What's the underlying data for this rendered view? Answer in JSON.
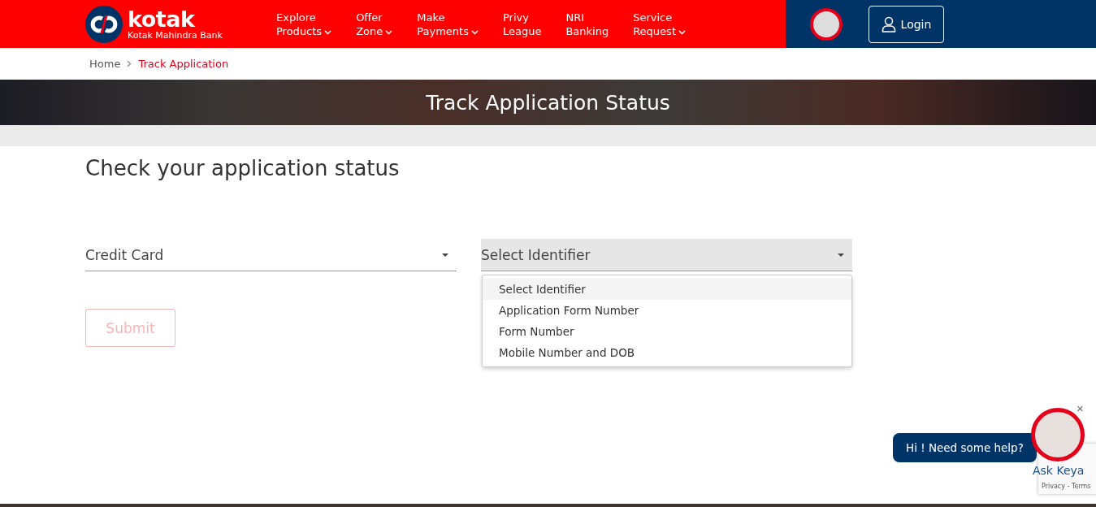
{
  "header": {
    "brand": "kotak",
    "brand_sub": "Kotak Mahindra Bank",
    "nav": [
      {
        "line1": "Explore",
        "line2": "Products",
        "caret": true
      },
      {
        "line1": "Offer",
        "line2": "Zone",
        "caret": true
      },
      {
        "line1": "Make",
        "line2": "Payments",
        "caret": true
      },
      {
        "line1": "Privy",
        "line2": "League",
        "caret": false
      },
      {
        "line1": "NRI",
        "line2": "Banking",
        "caret": false
      },
      {
        "line1": "Service",
        "line2": "Request",
        "caret": true
      }
    ],
    "login": "Login"
  },
  "breadcrumb": [
    {
      "label": "Home",
      "selected": false
    },
    {
      "label": "Track Application",
      "selected": true
    }
  ],
  "banner": {
    "title": "Track Application Status"
  },
  "form": {
    "heading": "Check your application status",
    "product_select": {
      "value": "Credit Card"
    },
    "identifier_select": {
      "value": "Select Identifier",
      "expanded": true,
      "options": [
        {
          "label": "Select Identifier",
          "selected": true
        },
        {
          "label": "Application Form Number",
          "selected": false
        },
        {
          "label": "Form Number",
          "selected": false
        },
        {
          "label": "Mobile Number and DOB",
          "selected": false
        }
      ]
    },
    "submit": {
      "label": "Submit",
      "disabled": true
    }
  },
  "chat": {
    "bubble": "Hi ! Need some help?",
    "name": "Ask Keya",
    "close": "×",
    "recaptcha": "Privacy - Terms"
  }
}
